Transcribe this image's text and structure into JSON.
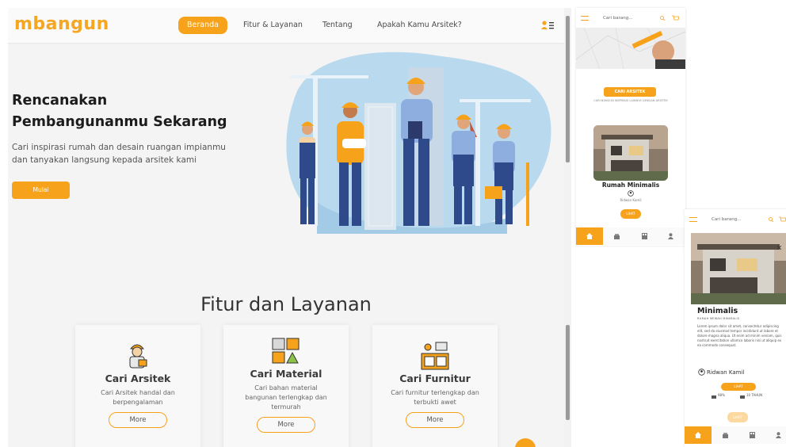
{
  "colors": {
    "accent": "#f7a21b",
    "logo": "#f5a623",
    "blob": "#9cc7e2",
    "text_dark": "#1c1c1c"
  },
  "desktop": {
    "logo": "mbangun",
    "nav": {
      "items": [
        "Beranda",
        "Fitur & Layanan",
        "Tentang",
        "Apakah Kamu Arsitek?"
      ],
      "active": "Beranda",
      "user_icon": "user-list-icon"
    },
    "hero": {
      "title_line1": "Rencanakan",
      "title_line2": "Pembangunanmu Sekarang",
      "subtitle_line1": "Cari inspirasi rumah dan desain ruangan impianmu",
      "subtitle_line2": "dan tanyakan langsung kepada arsitek kami",
      "cta": "Mulai"
    },
    "features": {
      "title": "Fitur dan Layanan",
      "cards": [
        {
          "title": "Cari Arsitek",
          "desc_line1": "Cari Arsitek handal dan",
          "desc_line2": "berpengalaman",
          "desc_line3": "",
          "button": "More",
          "icon": "architect-icon"
        },
        {
          "title": "Cari Material",
          "desc_line1": "Cari bahan material",
          "desc_line2": "bangunan terlengkap dan",
          "desc_line3": "termurah",
          "button": "More",
          "icon": "building-material-icon"
        },
        {
          "title": "Cari Furnitur",
          "desc_line1": "Cari furnitur terlengkap dan",
          "desc_line2": "terbukti awet",
          "desc_line3": "",
          "button": "More",
          "icon": "furniture-icon"
        }
      ]
    }
  },
  "mobile_home": {
    "search_placeholder": "Cari barang...",
    "cta": "CARI ARSITEK",
    "cta_sub": "CARI BANGUN INSPIRASI LAINNYA DENGAN ARSITEK",
    "project_name": "Rumah Minimalis",
    "author": "Ridwan Kamil",
    "button": "LIHAT",
    "tabs": [
      "home-icon",
      "store-icon",
      "building-icon",
      "profile-icon"
    ]
  },
  "mobile_detail": {
    "search_placeholder": "Cari barang...",
    "title": "Minimalis",
    "subtitle": "RUMAH MEWAH MINIMALIS",
    "description": "Lorem ipsum dolor sit amet, consectetur adipiscing elit, sed do eiusmod tempor incididunt ut labore et dolore magna aliqua. Ut enim ad minim veniam, quis nostrud exercitation ullamco laboris nisi ut aliquip ex ea commodo consequat.",
    "author": "Ridwan Kamil",
    "button": "LIHAT",
    "stat_likes": "98%",
    "stat_years": "10 TAHUN",
    "button2": "LIHAT",
    "tabs": [
      "home-icon",
      "store-icon",
      "building-icon",
      "profile-icon"
    ]
  }
}
